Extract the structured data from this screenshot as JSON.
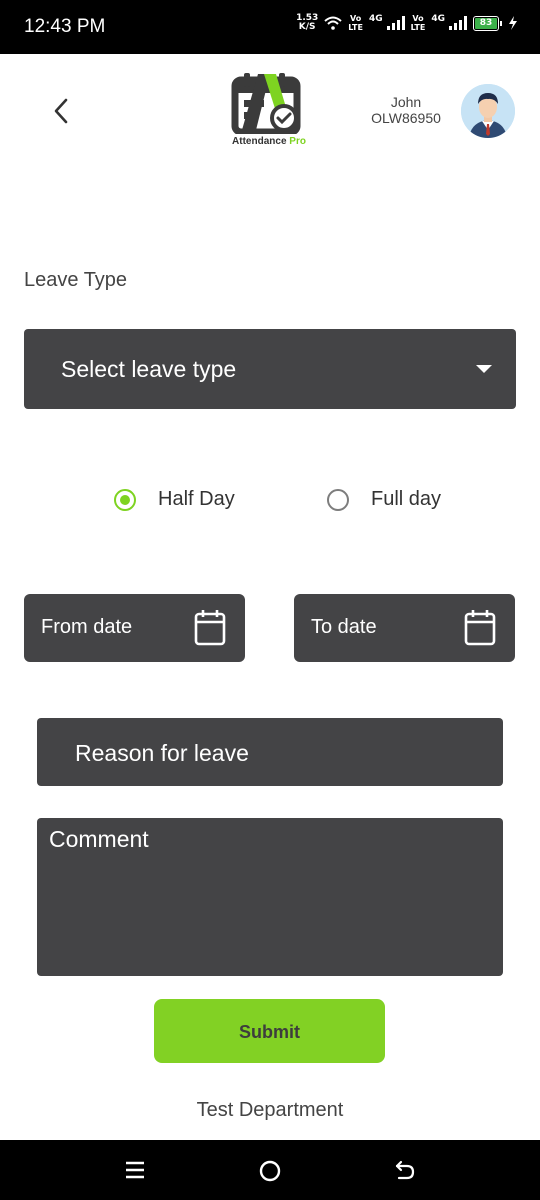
{
  "status_bar": {
    "time": "12:43 PM",
    "net_speed_value": "1.53",
    "net_speed_unit": "K/S",
    "sim1_tag_top": "Vo",
    "sim1_tag_bottom": "LTE",
    "sim1_gen": "4G",
    "sim2_tag_top": "Vo",
    "sim2_tag_bottom": "LTE",
    "sim2_gen": "4G",
    "battery": "83",
    "icons": [
      "wifi-icon",
      "signal-icon",
      "signal-icon",
      "battery-icon",
      "charging-icon"
    ]
  },
  "header": {
    "logo_text": "Attendance",
    "logo_text_accent": "Pro",
    "user_name": "John",
    "user_id": "OLW86950"
  },
  "form": {
    "leave_type_label": "Leave Type",
    "leave_type_placeholder": "Select leave type",
    "radio_options": [
      {
        "label": "Half Day",
        "selected": true
      },
      {
        "label": "Full day",
        "selected": false
      }
    ],
    "from_date_placeholder": "From date",
    "to_date_placeholder": "To date",
    "reason_placeholder": "Reason for leave",
    "comment_placeholder": "Comment",
    "submit_label": "Submit"
  },
  "footer": {
    "department": "Test Department"
  },
  "colors": {
    "accent": "#82d124",
    "field_bg": "#444446"
  }
}
